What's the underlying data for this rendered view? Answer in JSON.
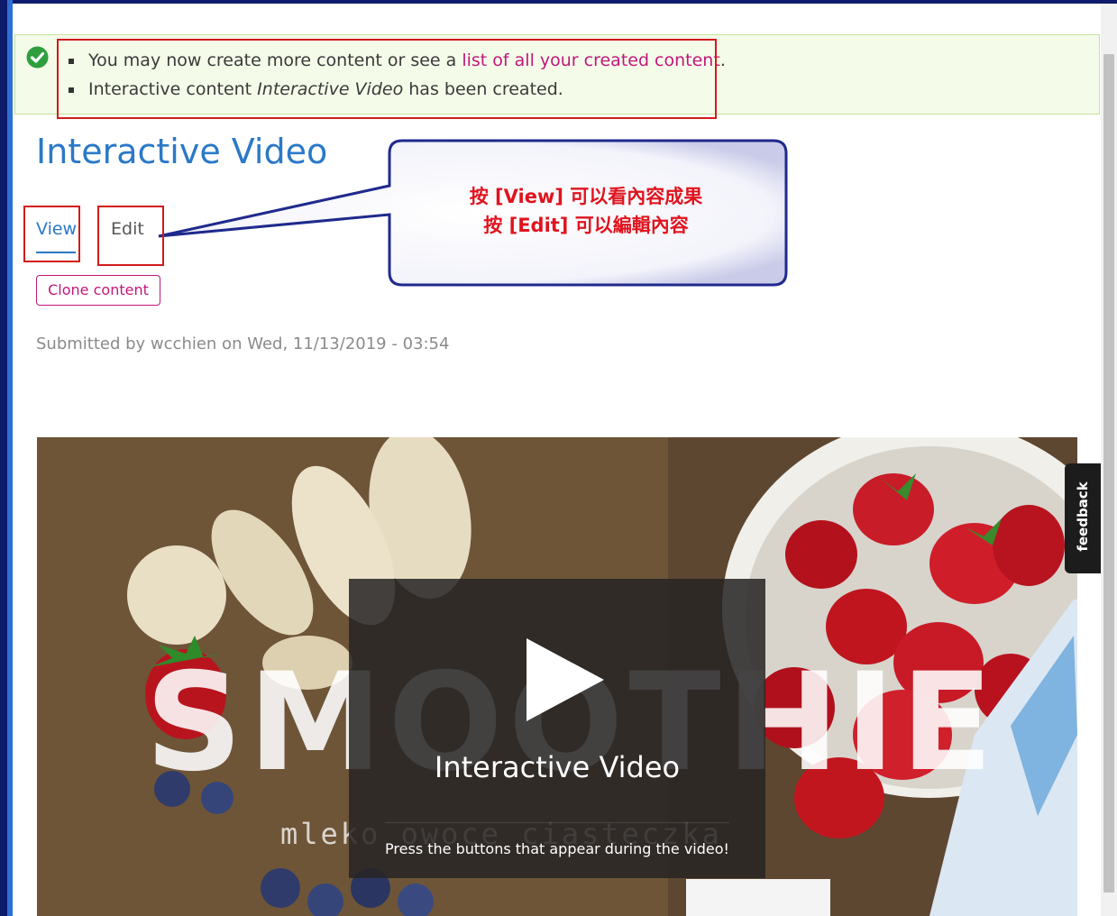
{
  "status_messages": {
    "line1_prefix": "You may now create more content or see a ",
    "line1_link": "list of all your created content",
    "line1_suffix": ".",
    "line2_prefix": "Interactive content ",
    "line2_em": "Interactive Video",
    "line2_suffix": " has been created."
  },
  "page": {
    "title": "Interactive Video",
    "submitted": "Submitted by wcchien on Wed, 11/13/2019 - 03:54"
  },
  "tabs": [
    {
      "label": "View",
      "active": true
    },
    {
      "label": "Edit",
      "active": false
    }
  ],
  "actions": {
    "clone_label": "Clone content"
  },
  "callout": {
    "line1": "按 [View] 可以看內容成果",
    "line2": "按 [Edit] 可以編輯內容"
  },
  "video": {
    "title": "Interactive Video",
    "description": "Press the buttons that appear during the video!",
    "overlay_word": "SMOOTHIE",
    "overlay_subtitle": "mleko  owoce  ciasteczka"
  },
  "feedback": {
    "label": "feedback"
  },
  "colors": {
    "link": "#2b79c7",
    "accent": "#c2187a",
    "annotation_red": "#d21a1a",
    "success_bg": "#f4fbe9"
  }
}
